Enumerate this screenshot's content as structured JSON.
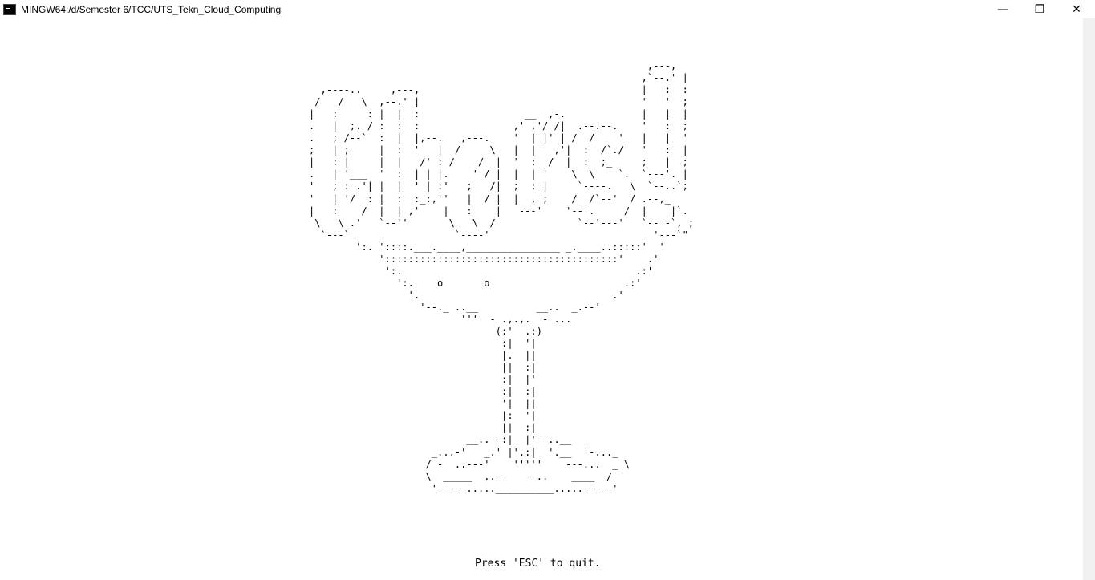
{
  "window": {
    "title": "MINGW64:/d/Semester 6/TCC/UTS_Tekn_Cloud_Computing",
    "controls": {
      "minimize": "—",
      "maximize": "❐",
      "close": "✕"
    }
  },
  "terminal": {
    "art": "                                                          ,---,\n                                                         ,`--.' |\n  ,----..     ,---,                                      |   :  :\n /   /   \\  ,--.' |                                      '   '  ;\n|   :     : |  |  :                  __  ,-.             |   |  |\n.   |  ;. / :  :  :                ,' ,'/ /|  .--.--.    '   :  ;\n.   ; /--`  :  |  |,--.   ,---.    '  | |' | /  /    '   |   |  '\n;   | ;     |  :  '   |  /     \\   |  |   ,'|  :  /`./   '   :  |\n|   : |     |  |   /' : /    /  |  '  :  /  |  :  ;_     ;   |  ;\n.   | '___  '  :  | | |.    ' / |  |  | '    \\  \\    `.  `---'. |\n'   ; : .'| |  |  ' | :'   ;   /|  ;  : |     `----.   \\  `--..`;\n'   | '/  : |  :  :_:,''   |  / |  |  , ;    /  /`--'  / .--,_\n|   :    /  |  | ,'    |   :    |   ---'    '--'.     /  |    |`.\n \\   \\ .'   `--''       \\   \\  /              `--'---'   `-- -`, ;\n  `---`                  `----'                            '---`\"\n        ':. '::::.___.____,________________ _.____..:::::'  '\n            '::::::::::::::::::::::::::::::::::::::::'    .'\n             ':.                                        .:'\n               ':.    o       o                       .:'\n                 '.                                 .'\n                   '--._ ..__          __..  _.--'\n                          '''  - .,.,.  - ...\n                                (:'  .:)\n                                 :|  '|\n                                 |.  ||\n                                 ||  :|\n                                 :|  |'\n                                 :|  :|\n                                 '|  ||\n                                 |:  '|\n                                 ||  :|\n                           __..--:|  |'--..__\n                     _...-'   _.' |'.:|  '.__  '-..._\n                    / -  ..---'    '''''    ---...  _ \\\n                    \\  _____  ..--   --..    ____  /\n                     '-----.....__________.....-----'",
    "prompt": "Press 'ESC' to quit."
  }
}
